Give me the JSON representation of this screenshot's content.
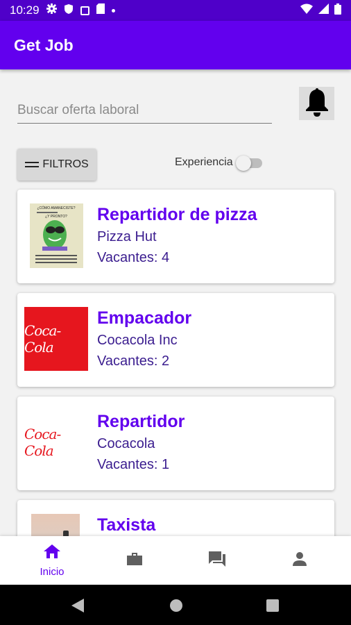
{
  "status_bar": {
    "time": "10:29"
  },
  "app_bar": {
    "title": "Get Job"
  },
  "search": {
    "placeholder": "Buscar oferta laboral"
  },
  "filters": {
    "label": "FILTROS"
  },
  "experience": {
    "label": "Experiencia",
    "enabled": false
  },
  "jobs": [
    {
      "title": "Repartidor de pizza",
      "company": "Pizza Hut",
      "vacancies": "Vacantes: 4",
      "logo_lines": [
        "¿CÓMO AMANECISTE?",
        "¿Y PRONTO?"
      ]
    },
    {
      "title": "Empacador",
      "company": "Cocacola Inc",
      "vacancies": "Vacantes: 2",
      "logo_text": "Coca-Cola"
    },
    {
      "title": "Repartidor",
      "company": "Cocacola",
      "vacancies": "Vacantes: 1",
      "logo_text": "Coca-Cola"
    },
    {
      "title": "Taxista"
    }
  ],
  "bottom_nav": {
    "items": [
      {
        "label": "Inicio",
        "icon": "home-icon"
      },
      {
        "label": "",
        "icon": "briefcase-icon"
      },
      {
        "label": "",
        "icon": "chat-icon"
      },
      {
        "label": "",
        "icon": "person-icon"
      }
    ]
  },
  "colors": {
    "primary": "#6200ee",
    "status_bar": "#4f00c9",
    "coca_red": "#e6161e"
  }
}
